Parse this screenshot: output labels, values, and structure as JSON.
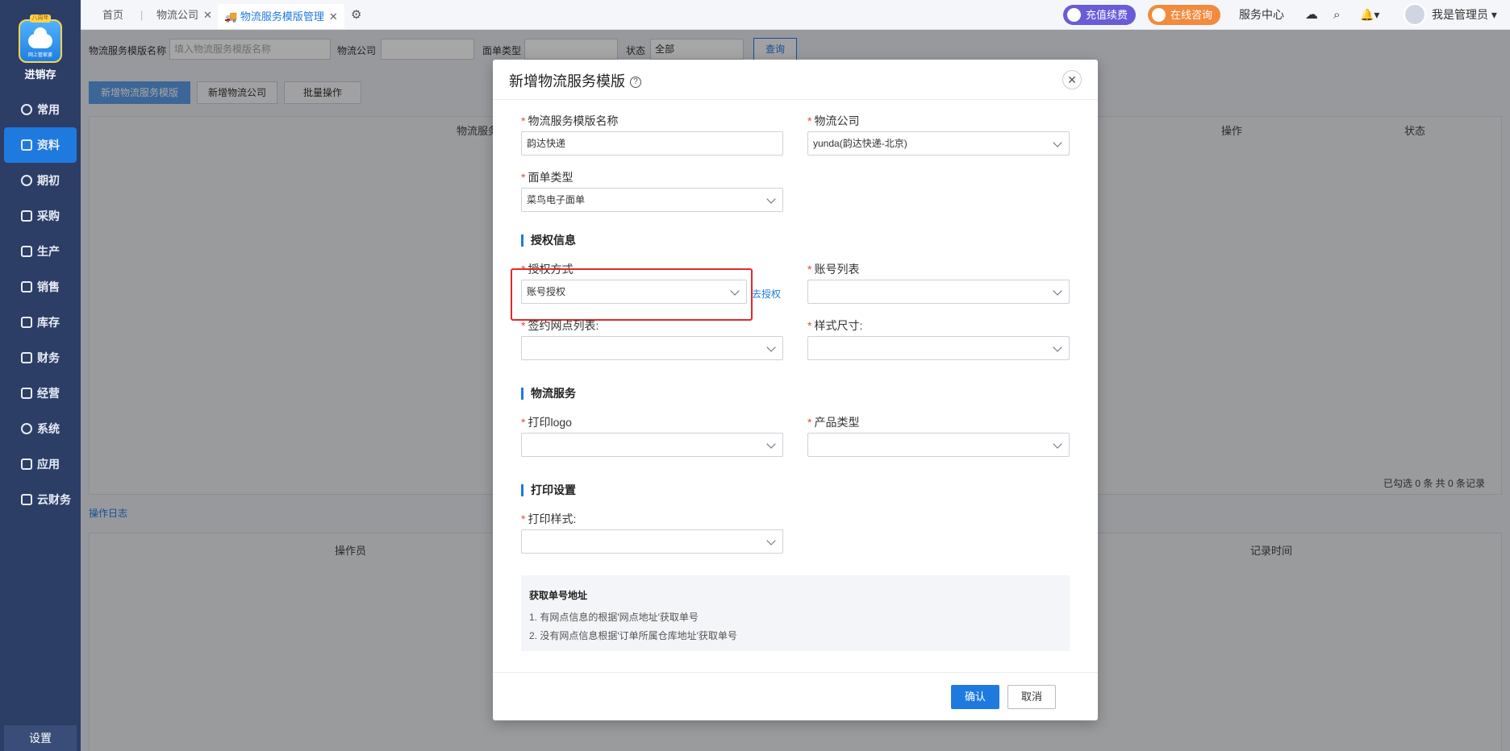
{
  "app": {
    "name": "进销存",
    "logo_tag": "八周年",
    "logo_sub": "网上管家婆",
    "settings_label": "设置"
  },
  "sidebar": {
    "items": [
      {
        "label": "常用",
        "icon": "star-icon"
      },
      {
        "label": "资料",
        "icon": "document-icon",
        "active": true
      },
      {
        "label": "期初",
        "icon": "target-icon"
      },
      {
        "label": "采购",
        "icon": "purchase-icon"
      },
      {
        "label": "生产",
        "icon": "production-icon"
      },
      {
        "label": "销售",
        "icon": "chart-icon"
      },
      {
        "label": "库存",
        "icon": "warehouse-icon"
      },
      {
        "label": "财务",
        "icon": "finance-icon"
      },
      {
        "label": "经营",
        "icon": "business-icon"
      },
      {
        "label": "系统",
        "icon": "gear-icon"
      },
      {
        "label": "应用",
        "icon": "plus-icon"
      },
      {
        "label": "云财务",
        "icon": "cloud-finance-icon"
      }
    ]
  },
  "tabs": {
    "home": "首页",
    "logistics_company": "物流公司",
    "template_mgmt": "物流服务模版管理"
  },
  "topbar": {
    "recharge": "充值续费",
    "consult": "在线咨询",
    "service_center": "服务中心",
    "user": "我是管理员"
  },
  "filters": {
    "template_name_label": "物流服务模版名称",
    "template_name_placeholder": "填入物流服务模版名称",
    "company_label": "物流公司",
    "waybill_type_label": "面单类型",
    "status_label": "状态",
    "status_value": "全部",
    "query_btn": "查询"
  },
  "toolbar": {
    "new_template": "新增物流服务模版",
    "new_company": "新增物流公司",
    "batch": "批量操作"
  },
  "grid": {
    "col_name": "物流服务模版名称",
    "col_action": "操作",
    "col_status": "状态",
    "summary": "已勾选 0 条  共 0 条记录"
  },
  "log": {
    "tab": "操作日志",
    "col_operator": "操作员",
    "col_time": "记录时间"
  },
  "modal": {
    "title": "新增物流服务模版",
    "template_name_label": "物流服务模版名称",
    "template_name_value": "韵达快递",
    "company_label": "物流公司",
    "company_value": "yunda(韵达快递-北京)",
    "waybill_type_label": "面单类型",
    "waybill_type_value": "菜鸟电子面单",
    "auth_section": "授权信息",
    "auth_method_label": "授权方式",
    "auth_method_value": "账号授权",
    "go_auth_link": "去授权",
    "account_list_label": "账号列表",
    "branch_list_label": "签约网点列表:",
    "style_size_label": "样式尺寸:",
    "service_section": "物流服务",
    "print_logo_label": "打印logo",
    "product_type_label": "产品类型",
    "print_section": "打印设置",
    "print_style_label": "打印样式:",
    "info_title": "获取单号地址",
    "info_line1": "1.  有网点信息的根据'网点地址'获取单号",
    "info_line2": "2.  没有网点信息根据'订单所属仓库地址'获取单号",
    "ok_btn": "确认",
    "cancel_btn": "取消"
  }
}
